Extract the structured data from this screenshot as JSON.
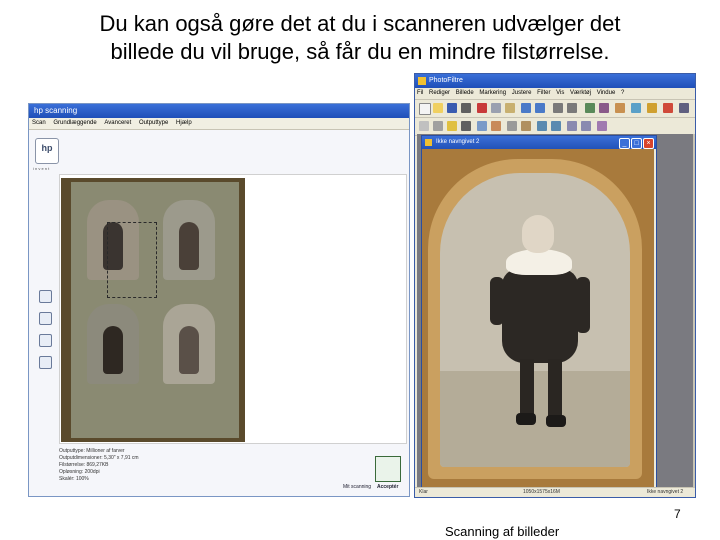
{
  "slide": {
    "title_line1": "Du kan også gøre det at du i scanneren udvælger det",
    "title_line2": "billede du vil bruge, så får du en mindre filstørrelse.",
    "page_number": "7",
    "footer": "Scanning af billeder"
  },
  "hp_window": {
    "title": "hp scanning",
    "menu": [
      "Scan",
      "Grundlæggende",
      "Avanceret",
      "Outputtype",
      "Hjælp"
    ],
    "logo_text": "hp",
    "logo_sub": "i n v e n t",
    "info_lines": [
      "Outputtype: Millioner af farver",
      "Outputdimensioner: 5,30\" x 7,91 cm",
      "Filstørrelse: 869,27KB",
      "Opløsning: 200dpi",
      "Skalér: 100%"
    ],
    "my_scanning_label": "Mit scanning",
    "accept_label": "Acceptér"
  },
  "photofiltre": {
    "title": "PhotoFiltre",
    "menu": [
      "Fil",
      "Rediger",
      "Billede",
      "Markering",
      "Justere",
      "Filter",
      "Vis",
      "Værktøj",
      "Vindue",
      "?"
    ],
    "document_title": "Ikke navngivet 2",
    "status_left": "Klar",
    "status_mid": "1050x1575x16M",
    "status_right": "Ikke navngivet 2"
  },
  "colors": {
    "title_bar": "#1f4fb8",
    "album": "#5a4a2c",
    "photo_frame": "#caa060"
  }
}
